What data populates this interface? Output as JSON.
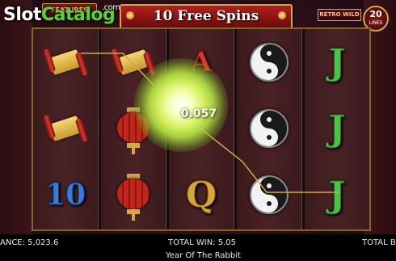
{
  "logo": {
    "part1": "Slot",
    "part2": "Catalog",
    "suffix": ".com"
  },
  "features_label": "FEATURES",
  "banner_title": "10 Free Spins",
  "retro_wild_label": "RETRO WILD",
  "lines": {
    "count": "20",
    "label": "LINES"
  },
  "win_amount": "0.057",
  "reel_grid": [
    [
      "scroll",
      "scroll",
      "symbol-10"
    ],
    [
      "scroll",
      "lantern",
      "lantern"
    ],
    [
      "symbol-a",
      "wild-glow",
      "symbol-q"
    ],
    [
      "yin-yang",
      "yin-yang",
      "yin-yang"
    ],
    [
      "symbol-j",
      "symbol-j",
      "symbol-j"
    ]
  ],
  "symbols": {
    "ten": "10",
    "a": "A",
    "q": "Q",
    "j": "J"
  },
  "bottom_bar": {
    "balance": "ANCE: 5,023.6",
    "total_win": "TOTAL WIN: 5.05",
    "total_bet": "TOTAL BE",
    "game_name": "Year Of The Rabbit"
  },
  "colors": {
    "banner": "#b41e1e",
    "gold": "#d4a844",
    "win_glow": "#d6f060",
    "payline": "#d4a844"
  }
}
